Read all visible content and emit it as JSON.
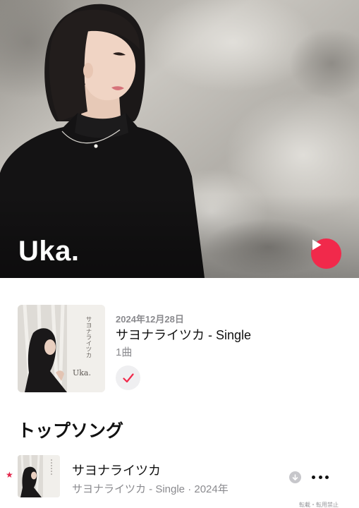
{
  "artist": {
    "name": "Uka."
  },
  "latest_release": {
    "date": "2024年12月28日",
    "title": "サヨナライツカ - Single",
    "track_count": "1曲",
    "cover_text": "サヨナライツカ",
    "cover_logo": "Uka."
  },
  "top_songs": {
    "section_title": "トップソング",
    "items": [
      {
        "title": "サヨナライツカ",
        "subtitle": "サヨナライツカ - Single · 2024年",
        "favorite_mark": "★"
      }
    ]
  },
  "watermark": "転載・転用禁止",
  "colors": {
    "accent": "#f1294b",
    "secondary_text": "#8a8a8e",
    "star": "#e3254a"
  },
  "icons": {
    "hero_play": "play-icon",
    "added": "checkmark-icon",
    "download": "download-arrow-icon",
    "more": "ellipsis-icon"
  }
}
